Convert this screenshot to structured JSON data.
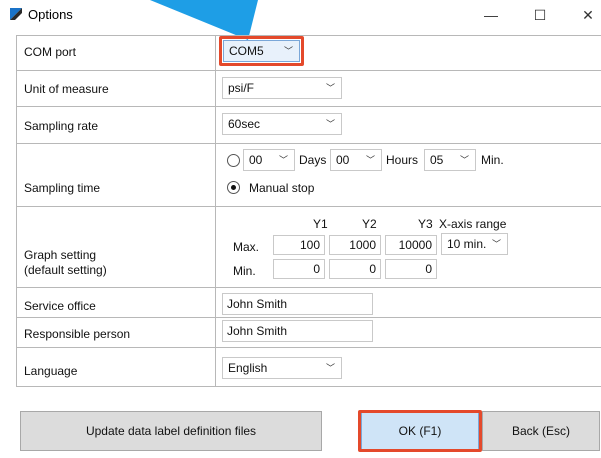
{
  "window": {
    "title": "Options",
    "minimize": "—",
    "maximize": "☐",
    "close": "✕"
  },
  "rows": {
    "com_port": {
      "label": "COM port",
      "value": "COM5"
    },
    "unit": {
      "label": "Unit of measure",
      "value": "psi/F"
    },
    "sampling_rate": {
      "label": "Sampling rate",
      "value": "60sec"
    },
    "sampling_time": {
      "label": "Sampling time",
      "days": "00",
      "days_label": "Days",
      "hours": "00",
      "hours_label": "Hours",
      "min": "05",
      "min_label": "Min.",
      "manual_stop": "Manual stop",
      "selected": "manual"
    },
    "graph": {
      "label_line1": "Graph setting",
      "label_line2": "(default setting)",
      "headers": [
        "Y1",
        "Y2",
        "Y3",
        "X-axis range"
      ],
      "max_label": "Max.",
      "min_label": "Min.",
      "max_values": [
        "100",
        "1000",
        "10000"
      ],
      "min_values": [
        "0",
        "0",
        "0"
      ],
      "x_range": "10 min."
    },
    "service_office": {
      "label": "Service office",
      "value": "John Smith"
    },
    "responsible": {
      "label": "Responsible person",
      "value": "John Smith"
    },
    "language": {
      "label": "Language",
      "value": "English"
    }
  },
  "buttons": {
    "update": "Update data label definition files",
    "ok": "OK (F1)",
    "back": "Back (Esc)"
  },
  "colors": {
    "highlight": "#e4492b",
    "pointer": "#1e9ee6"
  }
}
